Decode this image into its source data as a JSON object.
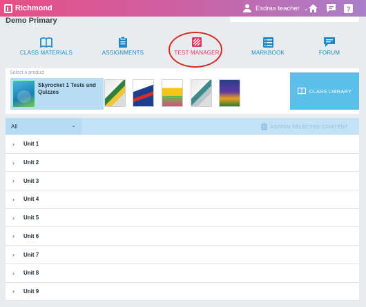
{
  "app": {
    "brand": "Richmond",
    "user_name": "Esdras teacher"
  },
  "header": {
    "school": "Demo Primary"
  },
  "nav": [
    {
      "label": "CLASS MATERIALS",
      "icon": "book-open-icon",
      "active": false
    },
    {
      "label": "ASSIGNMENTS",
      "icon": "clipboard-icon",
      "active": false
    },
    {
      "label": "TEST MANAGER",
      "icon": "test-manager-icon",
      "active": true
    },
    {
      "label": "MARKBOOK",
      "icon": "list-check-icon",
      "active": false
    },
    {
      "label": "FORUM",
      "icon": "chat-icon",
      "active": false
    }
  ],
  "products": {
    "label": "Select a product",
    "selected": "Skyrocket 1 Tests and Quizzes",
    "class_library": "CLASS LIBRARY"
  },
  "filter": {
    "value": "All",
    "assign_label": "ASSIGN SELECTED CONTENT"
  },
  "units": [
    "Unit 1",
    "Unit 2",
    "Unit 3",
    "Unit 4",
    "Unit 5",
    "Unit 6",
    "Unit 7",
    "Unit 8",
    "Unit 9"
  ],
  "colors": {
    "accent": "#1f88c9",
    "active": "#e5325c",
    "brand_start": "#e64f86",
    "brand_end": "#a97fc8"
  }
}
